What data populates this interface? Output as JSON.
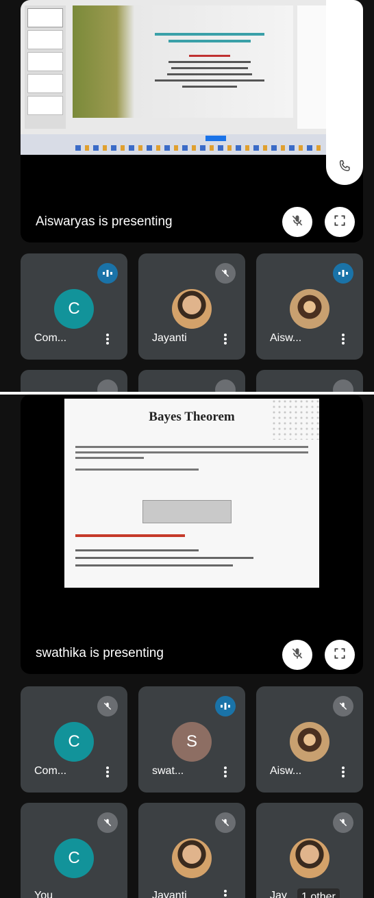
{
  "screen1": {
    "presenting_label": "Aiswaryas is presenting",
    "participants": [
      {
        "name": "Com...",
        "initial": "C",
        "avatar_color": "#12939a",
        "status": "speaking"
      },
      {
        "name": "Jayanti",
        "initial": "",
        "avatar_color": "#b37a3f",
        "status": "muted"
      },
      {
        "name": "Aisw...",
        "initial": "",
        "avatar_color": "#6a4a2e",
        "status": "speaking"
      }
    ]
  },
  "screen2": {
    "presenting_label": "swathika is presenting",
    "slide": {
      "title": "Bayes Theorem"
    },
    "participants": [
      {
        "name": "Com...",
        "initial": "C",
        "avatar_color": "#12939a",
        "status": "muted"
      },
      {
        "name": "swat...",
        "initial": "S",
        "avatar_color": "#8d6e63",
        "status": "speaking"
      },
      {
        "name": "Aisw...",
        "initial": "",
        "avatar_color": "#6a4a2e",
        "status": "muted"
      },
      {
        "name": "You",
        "initial": "C",
        "avatar_color": "#12939a",
        "status": "muted"
      },
      {
        "name": "Jayanti",
        "initial": "",
        "avatar_color": "#b37a3f",
        "status": "muted"
      },
      {
        "name": "Jay",
        "initial": "",
        "avatar_color": "#b37a3f",
        "status": "muted",
        "overlay": "1 other"
      }
    ]
  },
  "colors": {
    "talk_badge": "#1a73a8",
    "muted_badge": "#6b6e72",
    "tile_bg": "#3c4043"
  }
}
